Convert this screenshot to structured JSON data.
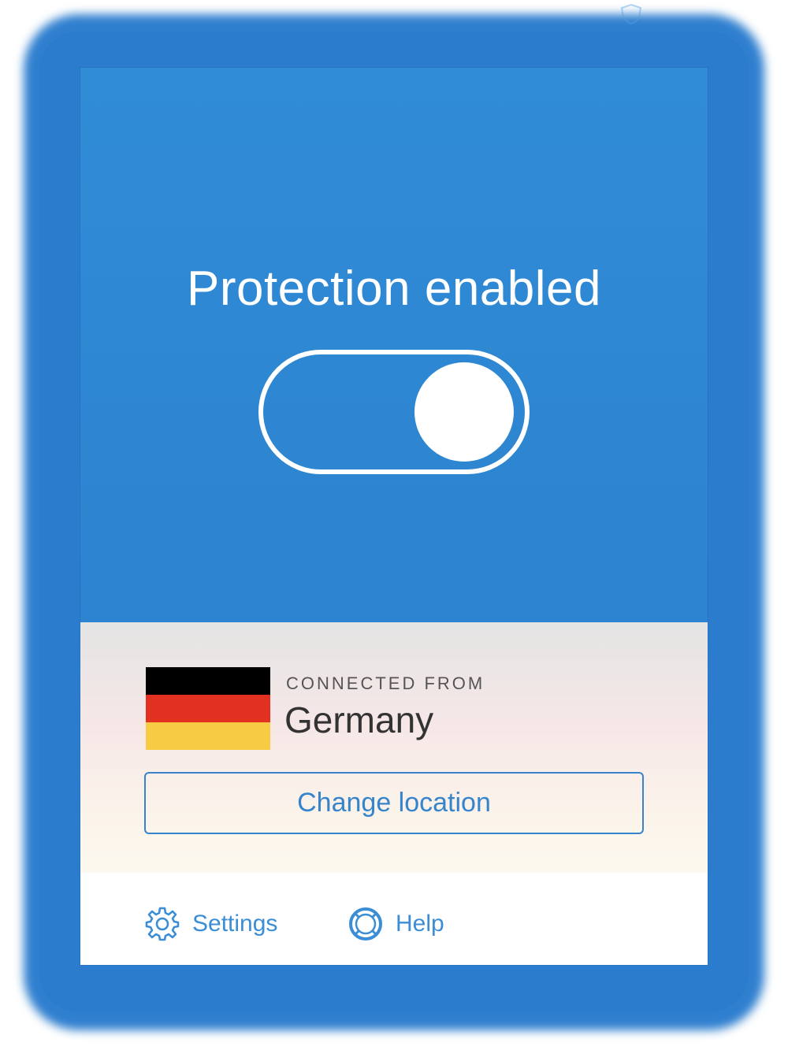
{
  "status": {
    "title": "Protection enabled",
    "toggle_on": true
  },
  "location": {
    "connected_label": "CONNECTED FROM",
    "country": "Germany",
    "flag_icon": "germany-flag-icon",
    "change_button_label": "Change location"
  },
  "footer": {
    "settings_label": "Settings",
    "settings_icon": "gear-icon",
    "help_label": "Help",
    "help_icon": "lifebuoy-icon"
  },
  "colors": {
    "accent": "#2e86d1",
    "link": "#3584cc",
    "flag_black": "#000000",
    "flag_red": "#e23120",
    "flag_gold": "#f8cb45"
  }
}
